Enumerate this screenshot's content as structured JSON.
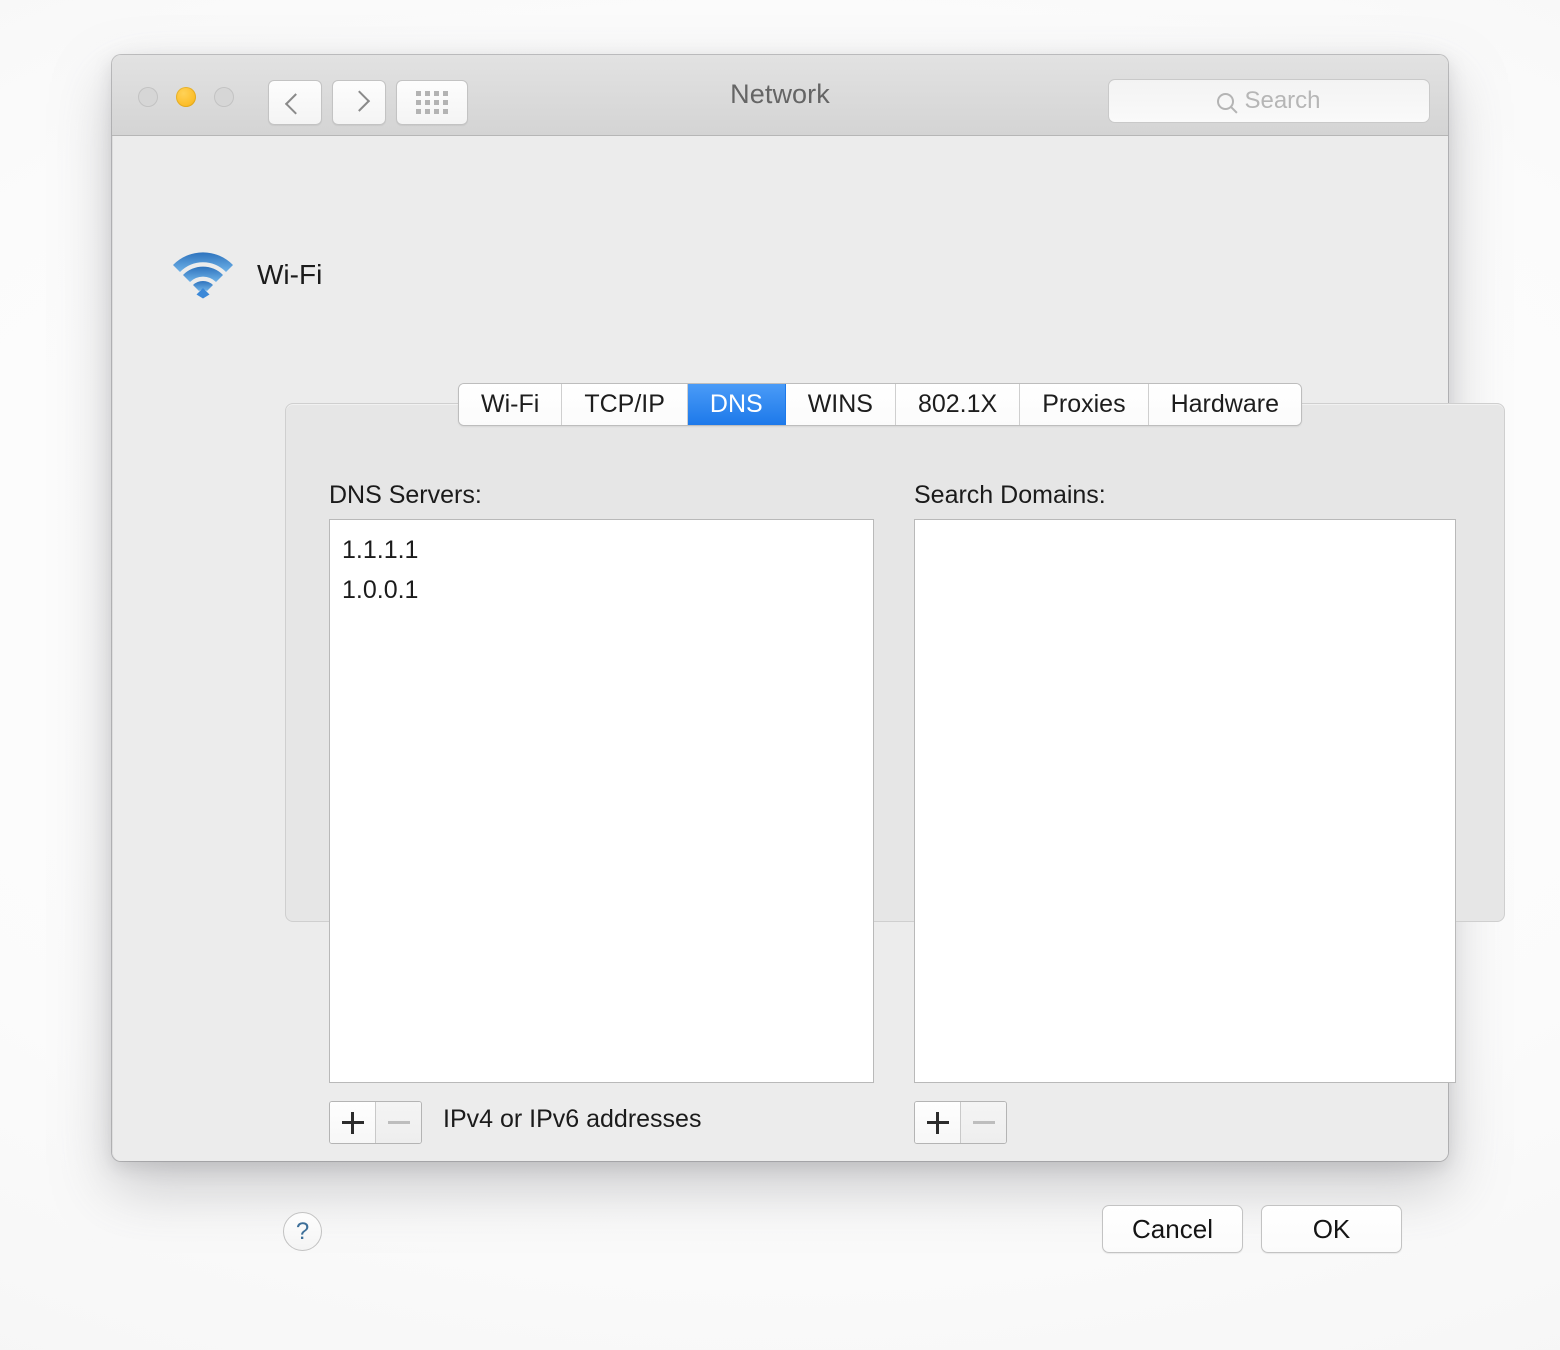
{
  "window": {
    "title": "Network",
    "traffic_lights": [
      {
        "name": "close",
        "color": "#d6d6d6",
        "enabled": false
      },
      {
        "name": "minimize",
        "color": "#fcbf2d",
        "enabled": true
      },
      {
        "name": "zoom",
        "color": "#d6d6d6",
        "enabled": false
      }
    ],
    "toolbar": {
      "back_icon": "chevron-left-icon",
      "forward_icon": "chevron-right-icon",
      "show_all_icon": "grid-icon"
    },
    "search": {
      "placeholder": "Search",
      "value": "",
      "icon": "search-icon"
    }
  },
  "service": {
    "name": "Wi-Fi",
    "icon": "wifi-icon",
    "icon_color": "#3b84d0"
  },
  "tabs": [
    {
      "label": "Wi-Fi",
      "selected": false
    },
    {
      "label": "TCP/IP",
      "selected": false
    },
    {
      "label": "DNS",
      "selected": true
    },
    {
      "label": "WINS",
      "selected": false
    },
    {
      "label": "802.1X",
      "selected": false
    },
    {
      "label": "Proxies",
      "selected": false
    },
    {
      "label": "Hardware",
      "selected": false
    }
  ],
  "selected_tab_color": "#1d79ea",
  "dns_panel": {
    "dns_servers": {
      "label": "DNS Servers:",
      "entries": [
        "1.1.1.1",
        "1.0.0.1"
      ],
      "hint": "IPv4 or IPv6 addresses",
      "add_button": {
        "glyph": "+",
        "enabled": true
      },
      "remove_button": {
        "glyph": "−",
        "enabled": false
      }
    },
    "search_domains": {
      "label": "Search Domains:",
      "entries": [],
      "add_button": {
        "glyph": "+",
        "enabled": true
      },
      "remove_button": {
        "glyph": "−",
        "enabled": false
      }
    }
  },
  "footer": {
    "help_label": "?",
    "cancel_label": "Cancel",
    "ok_label": "OK"
  }
}
